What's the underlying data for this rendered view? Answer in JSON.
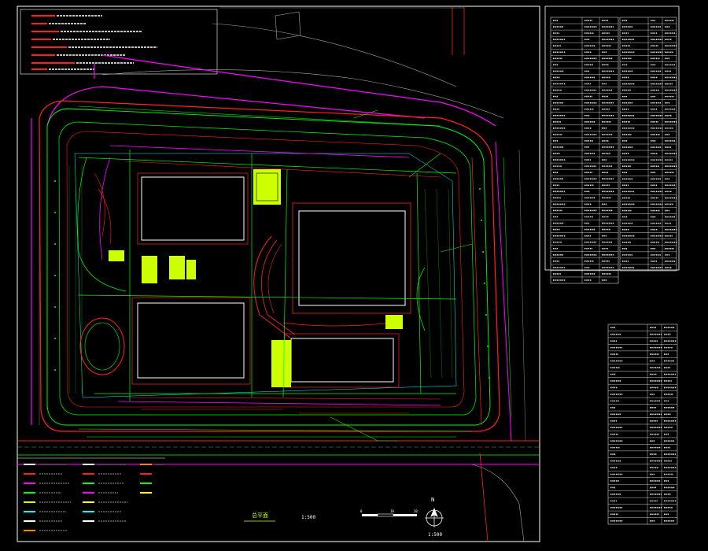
{
  "drawing": {
    "plan_title": "总平面",
    "plan_scale": "1:500",
    "bar_scale_labels": [
      "0",
      "10",
      "20"
    ],
    "north_label": "N",
    "bottom_scale": "1:500"
  },
  "colors": {
    "background": "#000000",
    "green": "#00ff00",
    "yellow_green": "#ccff00",
    "red": "#ff2020",
    "magenta": "#ff00ff",
    "cyan": "#00ffff",
    "yellow": "#ffff00",
    "white": "#ffffff",
    "orange": "#ff8000"
  }
}
